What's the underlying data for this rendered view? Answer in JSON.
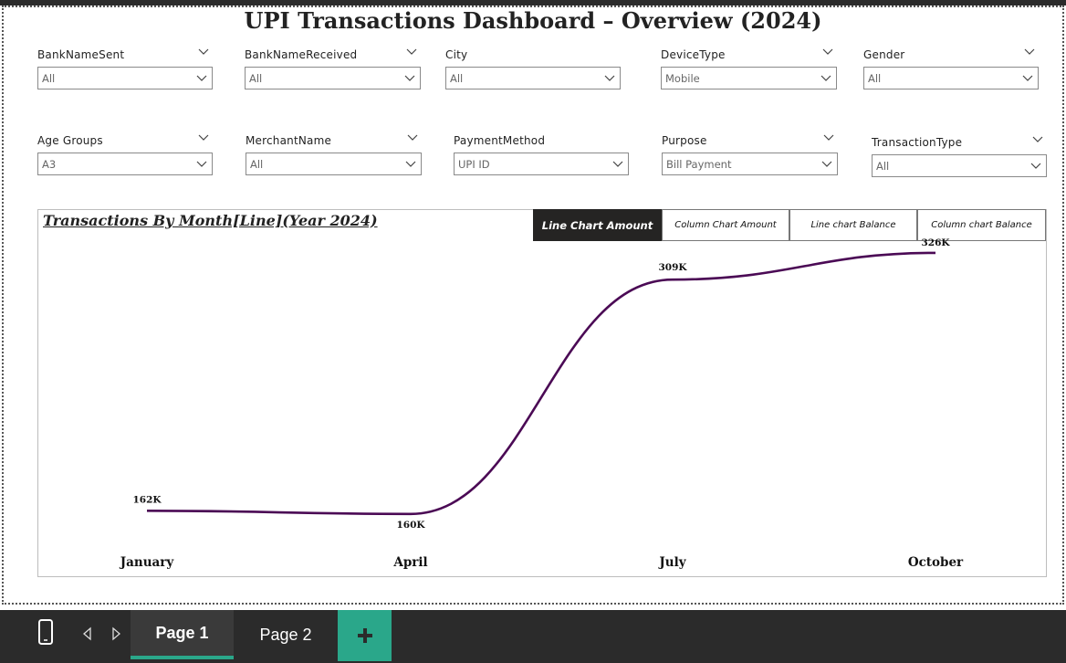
{
  "title": "UPI Transactions Dashboard – Overview (2024)",
  "slicers": [
    {
      "label": "BankNameSent",
      "value": "All"
    },
    {
      "label": "BankNameReceived",
      "value": "All"
    },
    {
      "label": "City",
      "value": "All"
    },
    {
      "label": "DeviceType",
      "value": "Mobile"
    },
    {
      "label": "Gender",
      "value": "All"
    },
    {
      "label": "Age Groups",
      "value": "A3"
    },
    {
      "label": "MerchantName",
      "value": "All"
    },
    {
      "label": "PaymentMethod",
      "value": "UPI ID"
    },
    {
      "label": "Purpose",
      "value": "Bill Payment"
    },
    {
      "label": "TransactionType",
      "value": "All"
    }
  ],
  "chart_buttons": [
    {
      "label": "Line Chart Amount",
      "active": true
    },
    {
      "label": "Column Chart Amount",
      "active": false
    },
    {
      "label": "Line chart Balance",
      "active": false
    },
    {
      "label": "Column chart Balance",
      "active": false
    }
  ],
  "chart_data": {
    "type": "line",
    "title": "Transactions By Month[Line](Year 2024)",
    "categories": [
      "January",
      "April",
      "July",
      "October"
    ],
    "values": [
      162000,
      160000,
      309000,
      326000
    ],
    "data_labels": [
      "162K",
      "160K",
      "309K",
      "326K"
    ],
    "ylim": [
      150000,
      330000
    ],
    "grid": false,
    "line_color": "#4b0a55"
  },
  "pages": [
    {
      "label": "Page 1",
      "active": true
    },
    {
      "label": "Page 2",
      "active": false
    }
  ],
  "colors": {
    "accent": "#2aa78a",
    "dark": "#2b2b2b",
    "active_button": "#252423"
  },
  "icons": {
    "mobile_layout": "phone-icon",
    "prev_page": "chevron-left-icon",
    "next_page": "chevron-right-icon",
    "add_page": "plus-icon",
    "dropdown": "chevron-down-icon"
  }
}
